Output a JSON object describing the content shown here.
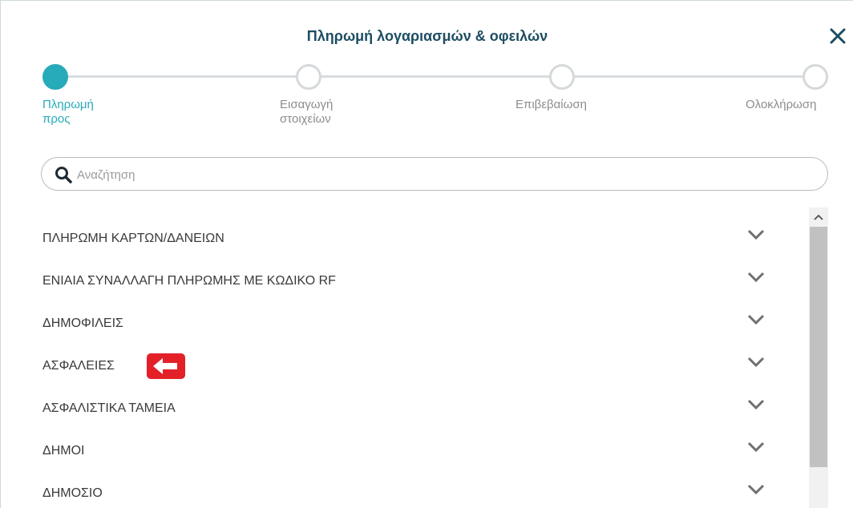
{
  "dialog": {
    "title": "Πληρωμή λογαριασμών & οφειλών",
    "close_icon": "close-icon"
  },
  "stepper": {
    "steps": [
      {
        "label_line1": "Πληρωμή",
        "label_line2": "προς",
        "active": true
      },
      {
        "label_line1": "Εισαγωγή",
        "label_line2": "στοιχείων",
        "active": false
      },
      {
        "label_line1": "Επιβεβαίωση",
        "label_line2": "",
        "active": false
      },
      {
        "label_line1": "Ολοκλήρωση",
        "label_line2": "",
        "active": false
      }
    ]
  },
  "search": {
    "placeholder": "Αναζήτηση",
    "value": ""
  },
  "categories": [
    {
      "label": "ΠΛΗΡΩΜΗ ΚΑΡΤΩΝ/ΔΑΝΕΙΩΝ"
    },
    {
      "label": "ΕΝΙΑΙΑ ΣΥΝΑΛΛΑΓΗ ΠΛΗΡΩΜΗΣ ΜΕ ΚΩΔΙΚΟ RF"
    },
    {
      "label": "ΔΗΜΟΦΙΛΕΙΣ"
    },
    {
      "label": "ΑΣΦΑΛΕΙΕΣ",
      "highlighted": true
    },
    {
      "label": "ΑΣΦΑΛΙΣΤΙΚΑ ΤΑΜΕΙΑ"
    },
    {
      "label": "ΔΗΜΟΙ"
    },
    {
      "label": "ΔΗΜΟΣΙΟ"
    }
  ],
  "colors": {
    "accent": "#27aab9",
    "title": "#1d4d63",
    "highlight_badge": "#e32028"
  }
}
